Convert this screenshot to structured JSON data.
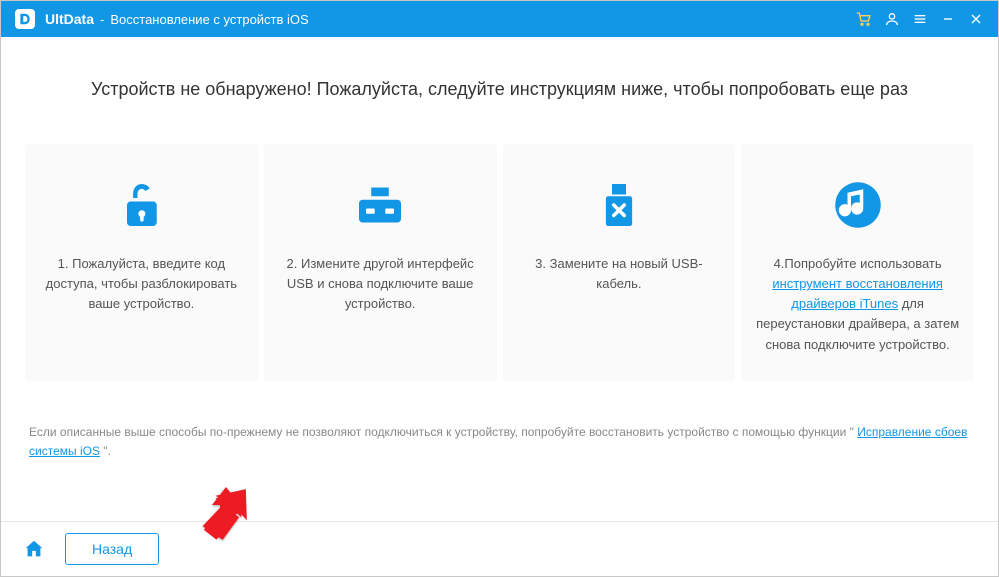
{
  "colors": {
    "accent": "#1296e6",
    "highlight": "#ffd24d"
  },
  "titlebar": {
    "app_name": "UltData",
    "subtitle": "Восстановление с устройств iOS"
  },
  "headline": "Устройств не обнаружено! Пожалуйста, следуйте инструкциям ниже, чтобы попробовать еще раз",
  "cards": [
    {
      "icon": "unlock-icon",
      "text": "1. Пожалуйста, введите код доступа, чтобы разблокировать ваше устройство."
    },
    {
      "icon": "usb-hub-icon",
      "text": "2. Измените другой интерфейс USB и снова подключите ваше устройство."
    },
    {
      "icon": "usb-cancel-icon",
      "text": "3. Замените на новый USB-кабель."
    },
    {
      "icon": "music-disc-icon",
      "text_prefix": "4.Попробуйте использовать ",
      "link_text": "инструмент восстановления драйверов iTunes",
      "text_suffix": "  для переустановки драйвера, а затем снова подключите устройство."
    }
  ],
  "bottom_note": {
    "prefix": "Если описанные выше способы по-прежнему не позволяют подключиться к устройству, попробуйте восстановить устройство с помощью функции \" ",
    "link_text": "Исправление сбоев системы iOS",
    "suffix": " \"."
  },
  "footer": {
    "back_label": "Назад"
  }
}
